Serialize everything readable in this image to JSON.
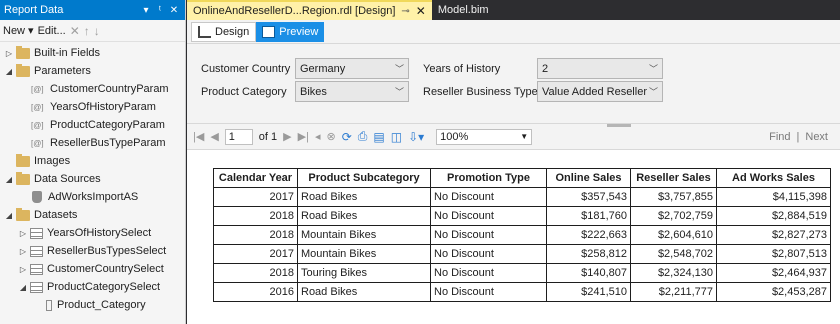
{
  "report_data_panel": {
    "title": "Report Data",
    "controls": [
      "▾",
      "ᵗ",
      "✕"
    ],
    "toolbar": {
      "new_label": "New ▾",
      "edit_label": "Edit...",
      "delete": "✕",
      "up": "↑",
      "down": "↓"
    },
    "tree": [
      {
        "label": "Built-in Fields",
        "level": 0,
        "expander": "▷",
        "icon": "folder-icon"
      },
      {
        "label": "Parameters",
        "level": 0,
        "expander": "◢",
        "icon": "folder-icon"
      },
      {
        "label": "CustomerCountryParam",
        "level": 1,
        "icon": "parameter-icon"
      },
      {
        "label": "YearsOfHistoryParam",
        "level": 1,
        "icon": "parameter-icon"
      },
      {
        "label": "ProductCategoryParam",
        "level": 1,
        "icon": "parameter-icon"
      },
      {
        "label": "ResellerBusTypeParam",
        "level": 1,
        "icon": "parameter-icon"
      },
      {
        "label": "Images",
        "level": 0,
        "expander": "",
        "icon": "folder-icon"
      },
      {
        "label": "Data Sources",
        "level": 0,
        "expander": "◢",
        "icon": "folder-icon"
      },
      {
        "label": "AdWorksImportAS",
        "level": 1,
        "icon": "datasource-icon"
      },
      {
        "label": "Datasets",
        "level": 0,
        "expander": "◢",
        "icon": "folder-icon"
      },
      {
        "label": "YearsOfHistorySelect",
        "level": 1,
        "expander": "▷",
        "icon": "dataset-icon"
      },
      {
        "label": "ResellerBusTypesSelect",
        "level": 1,
        "expander": "▷",
        "icon": "dataset-icon"
      },
      {
        "label": "CustomerCountrySelect",
        "level": 1,
        "expander": "▷",
        "icon": "dataset-icon"
      },
      {
        "label": "ProductCategorySelect",
        "level": 1,
        "expander": "◢",
        "icon": "dataset-icon"
      },
      {
        "label": "Product_Category",
        "level": 2,
        "icon": "field-icon"
      }
    ]
  },
  "tabs": [
    {
      "label": "OnlineAndResellerD...Region.rdl [Design]",
      "active": true,
      "pin": "⊸",
      "close": "✕"
    },
    {
      "label": "Model.bim",
      "active": false
    }
  ],
  "modes": {
    "design": "Design",
    "preview": "Preview"
  },
  "parameters": {
    "customer_country_label": "Customer Country",
    "customer_country_value": "Germany",
    "years_label": "Years of History",
    "years_value": "2",
    "product_category_label": "Product Category",
    "product_category_value": "Bikes",
    "reseller_type_label": "Reseller Business Type",
    "reseller_type_value": "Value Added Reseller"
  },
  "report_toolbar": {
    "page": "1",
    "of_pages": "of 1",
    "zoom": "100%",
    "find": "Find",
    "next": "Next"
  },
  "table": {
    "headers": [
      "Calendar Year",
      "Product Subcategory",
      "Promotion Type",
      "Online Sales",
      "Reseller Sales",
      "Ad Works Sales"
    ],
    "rows": [
      [
        "2017",
        "Road Bikes",
        "No Discount",
        "$357,543",
        "$3,757,855",
        "$4,115,398"
      ],
      [
        "2018",
        "Road Bikes",
        "No Discount",
        "$181,760",
        "$2,702,759",
        "$2,884,519"
      ],
      [
        "2018",
        "Mountain Bikes",
        "No Discount",
        "$222,663",
        "$2,604,610",
        "$2,827,273"
      ],
      [
        "2017",
        "Mountain Bikes",
        "No Discount",
        "$258,812",
        "$2,548,702",
        "$2,807,513"
      ],
      [
        "2018",
        "Touring Bikes",
        "No Discount",
        "$140,807",
        "$2,324,130",
        "$2,464,937"
      ],
      [
        "2016",
        "Road Bikes",
        "No Discount",
        "$241,510",
        "$2,211,777",
        "$2,453,287"
      ]
    ]
  }
}
